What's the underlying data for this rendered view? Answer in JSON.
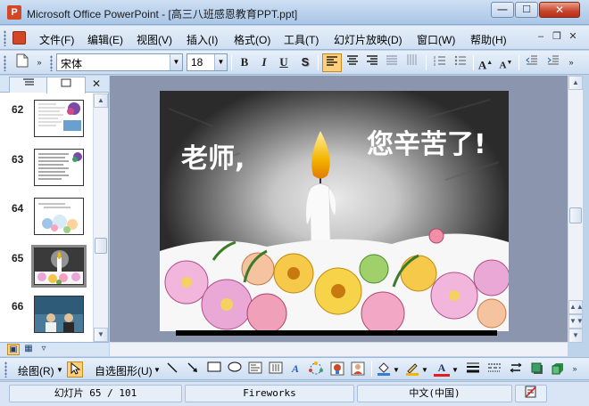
{
  "window": {
    "title": "Microsoft Office PowerPoint - [高三八班感恩教育PPT.ppt]",
    "app_icon_letter": "P",
    "min_glyph": "—",
    "max_glyph": "☐",
    "close_glyph": "✕"
  },
  "menubar": {
    "items": [
      "文件(F)",
      "编辑(E)",
      "视图(V)",
      "插入(I)",
      "格式(O)",
      "工具(T)",
      "幻灯片放映(D)",
      "窗口(W)",
      "帮助(H)"
    ]
  },
  "format_toolbar": {
    "font_name": "宋体",
    "font_size": "18",
    "bold": "B",
    "italic": "I",
    "underline": "U",
    "shadow": "S"
  },
  "outline_panel": {
    "close_glyph": "✕",
    "slides": [
      {
        "number": "62",
        "selected": false
      },
      {
        "number": "63",
        "selected": false
      },
      {
        "number": "64",
        "selected": false
      },
      {
        "number": "65",
        "selected": true
      },
      {
        "number": "66",
        "selected": false
      }
    ]
  },
  "slide": {
    "text_left": "老师,",
    "text_right": "您辛苦了!"
  },
  "drawing_toolbar": {
    "draw_label": "绘图(R)",
    "autoshapes_label": "自选图形(U)"
  },
  "statusbar": {
    "slide_position": "幻灯片 65 / 101",
    "design_template": "Fireworks",
    "language": "中文(中国)"
  },
  "colors": {
    "accent_highlight": "#ffcf7a",
    "title_bar": "#b9d1ec",
    "work_area": "#8b96ae",
    "candle_flame": "#f4b400"
  }
}
